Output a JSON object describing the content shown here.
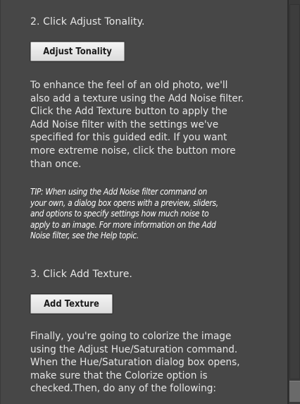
{
  "steps": {
    "step2": "2. Click Adjust Tonality.",
    "step3": "3. Click Add Texture."
  },
  "buttons": {
    "adjust_tonality": "Adjust Tonality",
    "add_texture": "Add Texture"
  },
  "paragraphs": {
    "texture": [
      "To enhance the feel of an old photo, we'll",
      "also add a texture using the Add Noise filter.",
      "Click the Add Texture button to apply the",
      "Add Noise filter with the settings we've",
      "specified for this guided edit. If you want",
      "more extreme noise, click the button more",
      "than once."
    ],
    "tip": [
      "TIP: When using the Add Noise filter command on",
      "your own, a dialog box opens with a preview, sliders,",
      "and options to specify settings how much noise to",
      "apply to an image. For more information on the Add",
      "Noise filter, see the Help topic."
    ],
    "colorize": [
      "Finally, you're going to colorize the image",
      "using the Adjust Hue/Saturation command.",
      "When the Hue/Saturation dialog box opens,",
      "make sure that the Colorize option is",
      "checked.Then, do any of the following:"
    ]
  },
  "colors": {
    "panel_bg": "#474747",
    "text": "#e6e6e6",
    "button_bg": "#e8e8e8"
  }
}
